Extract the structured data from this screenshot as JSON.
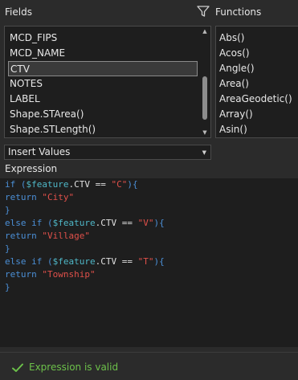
{
  "fields": {
    "title": "Fields",
    "items": [
      "MCD_FIPS",
      "MCD_NAME",
      "CTV",
      "NOTES",
      "LABEL",
      "Shape.STArea()",
      "Shape.STLength()"
    ],
    "selected": "CTV"
  },
  "functions": {
    "title": "Functions",
    "items": [
      "Abs()",
      "Acos()",
      "Angle()",
      "Area()",
      "AreaGeodetic()",
      "Array()",
      "Asin()"
    ]
  },
  "insert_dropdown": {
    "value": "Insert Values"
  },
  "expression": {
    "title": "Expression",
    "lines": [
      [
        {
          "t": "if",
          "c": "kw"
        },
        {
          "t": " (",
          "c": "pn"
        },
        {
          "t": "$feature",
          "c": "var"
        },
        {
          "t": ".CTV == ",
          "c": "id"
        },
        {
          "t": "\"C\"",
          "c": "str"
        },
        {
          "t": "){",
          "c": "pn"
        }
      ],
      [
        {
          "t": "return",
          "c": "kw"
        },
        {
          "t": " ",
          "c": "id"
        },
        {
          "t": "\"City\"",
          "c": "str"
        }
      ],
      [
        {
          "t": "}",
          "c": "pn"
        }
      ],
      [
        {
          "t": "else if",
          "c": "kw"
        },
        {
          "t": " (",
          "c": "pn"
        },
        {
          "t": "$feature",
          "c": "var"
        },
        {
          "t": ".CTV == ",
          "c": "id"
        },
        {
          "t": "\"V\"",
          "c": "str"
        },
        {
          "t": "){",
          "c": "pn"
        }
      ],
      [
        {
          "t": "return",
          "c": "kw"
        },
        {
          "t": " ",
          "c": "id"
        },
        {
          "t": "\"Village\"",
          "c": "str"
        }
      ],
      [
        {
          "t": "}",
          "c": "pn"
        }
      ],
      [
        {
          "t": "else if",
          "c": "kw"
        },
        {
          "t": " (",
          "c": "pn"
        },
        {
          "t": "$feature",
          "c": "var"
        },
        {
          "t": ".CTV == ",
          "c": "id"
        },
        {
          "t": "\"T\"",
          "c": "str"
        },
        {
          "t": "){",
          "c": "pn"
        }
      ],
      [
        {
          "t": "return",
          "c": "kw"
        },
        {
          "t": " ",
          "c": "id"
        },
        {
          "t": "\"Township\"",
          "c": "str"
        }
      ],
      [
        {
          "t": "}",
          "c": "pn"
        }
      ]
    ]
  },
  "status": {
    "message": "Expression is valid",
    "icon": "checkmark-icon",
    "color": "#6cc04a"
  }
}
